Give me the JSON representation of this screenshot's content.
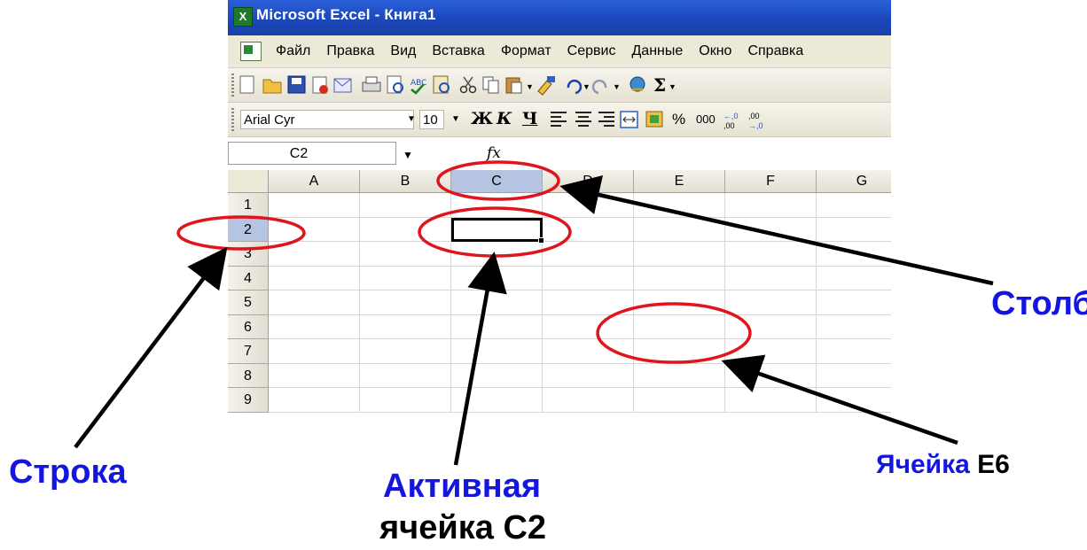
{
  "window": {
    "title": "Microsoft Excel - Книга1",
    "app_icon_letter": "X"
  },
  "menu": [
    "Файл",
    "Правка",
    "Вид",
    "Вставка",
    "Формат",
    "Сервис",
    "Данные",
    "Окно",
    "Справка"
  ],
  "format_toolbar": {
    "font": "Arial Cyr",
    "size": "10",
    "bold": "Ж",
    "italic": "К",
    "underline": "Ч",
    "percent": "%",
    "thousands": "000"
  },
  "formula_bar": {
    "name_box": "C2",
    "fx": "fx"
  },
  "grid": {
    "columns": [
      "A",
      "B",
      "C",
      "D",
      "E",
      "F",
      "G"
    ],
    "rows": [
      "1",
      "2",
      "3",
      "4",
      "5",
      "6",
      "7",
      "8",
      "9"
    ],
    "selected_column": "C",
    "selected_row": "2",
    "active_cell": "C2"
  },
  "annotations": {
    "row_label": "Строка",
    "column_label": "Столбец",
    "active_cell_label_line1": "Активная",
    "active_cell_label_line2": "ячейка С2",
    "cell_label_word": "Ячейка",
    "cell_label_ref": "Е6"
  },
  "colors": {
    "annotation_blue": "#1515e0",
    "ellipse_red": "#e0141c",
    "selection_blue": "#b5c4e0",
    "title_blue": "#1a46b8"
  }
}
